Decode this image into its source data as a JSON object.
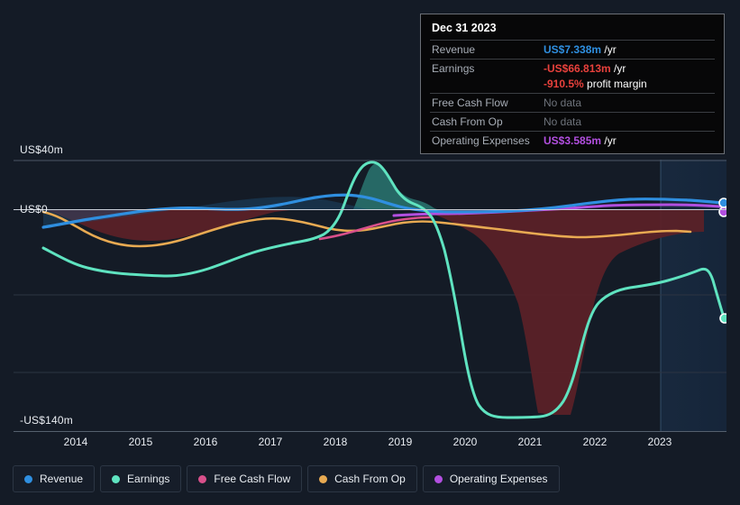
{
  "axes": {
    "y_top_label": "US$40m",
    "y_zero_label": "US$0",
    "y_bottom_label": "-US$140m",
    "x_ticks": [
      "2014",
      "2015",
      "2016",
      "2017",
      "2018",
      "2019",
      "2020",
      "2021",
      "2022",
      "2023"
    ]
  },
  "tooltip": {
    "date": "Dec 31 2023",
    "rows": [
      {
        "label": "Revenue",
        "value": "US$7.338m",
        "unit": " /yr",
        "color": "#2f8fe0",
        "nodata": false
      },
      {
        "label": "Earnings",
        "value": "-US$66.813m",
        "unit": " /yr",
        "color": "#e8413c",
        "nodata": false
      },
      {
        "label": "",
        "value": "-910.5%",
        "unit": " profit margin",
        "color": "#e8413c",
        "nodata": false,
        "sub": true
      },
      {
        "label": "Free Cash Flow",
        "value": "No data",
        "unit": "",
        "color": "#6e737b",
        "nodata": true
      },
      {
        "label": "Cash From Op",
        "value": "No data",
        "unit": "",
        "color": "#6e737b",
        "nodata": true
      },
      {
        "label": "Operating Expenses",
        "value": "US$3.585m",
        "unit": " /yr",
        "color": "#b24fe0",
        "nodata": false
      }
    ]
  },
  "legend": [
    {
      "label": "Revenue",
      "color": "#2f8fe0"
    },
    {
      "label": "Earnings",
      "color": "#5fe3c0"
    },
    {
      "label": "Free Cash Flow",
      "color": "#d9508b"
    },
    {
      "label": "Cash From Op",
      "color": "#e8aa52"
    },
    {
      "label": "Operating Expenses",
      "color": "#b24fe0"
    }
  ],
  "chart_data": {
    "type": "line",
    "title": "",
    "xlabel": "",
    "ylabel": "US$",
    "ylim": [
      -140,
      40
    ],
    "grid": true,
    "legend_position": "bottom",
    "currency": "USD",
    "units": "millions",
    "x": [
      "2013",
      "2014",
      "2015",
      "2016",
      "2017",
      "2018",
      "2018.5",
      "2019",
      "2019.5",
      "2020",
      "2020.5",
      "2021",
      "2021.5",
      "2022",
      "2022.5",
      "2023",
      "2023.5"
    ],
    "series": [
      {
        "name": "Revenue",
        "color": "#2f8fe0",
        "values": [
          -4.0,
          -1.0,
          2.0,
          3.0,
          4.5,
          7.0,
          12.0,
          9.0,
          5.5,
          4.0,
          4.0,
          5.0,
          6.5,
          7.5,
          7.8,
          7.5,
          7.338
        ]
      },
      {
        "name": "Earnings",
        "color": "#5fe3c0",
        "values": [
          -22.0,
          -8.0,
          -12.0,
          -28.0,
          -30.0,
          -20.0,
          32.0,
          28.0,
          12.0,
          -18.0,
          -35.0,
          -132.0,
          -140.0,
          -50.0,
          -42.0,
          -28.0,
          -66.813
        ]
      },
      {
        "name": "Free Cash Flow",
        "color": "#d9508b",
        "values": [
          null,
          null,
          null,
          null,
          null,
          -16.0,
          -13.0,
          -8.0,
          -6.0,
          null,
          null,
          null,
          null,
          null,
          null,
          null,
          null
        ]
      },
      {
        "name": "Cash From Op",
        "color": "#e8aa52",
        "values": [
          -2.0,
          -4.0,
          -14.0,
          -19.0,
          -14.0,
          -11.0,
          -6.0,
          -4.5,
          -7.0,
          -2.0,
          -5.0,
          -11.0,
          -12.0,
          -8.0,
          -10.0,
          -11.0,
          null
        ]
      },
      {
        "name": "Operating Expenses",
        "color": "#b24fe0",
        "values": [
          null,
          null,
          null,
          null,
          null,
          null,
          null,
          2.5,
          2.6,
          2.5,
          2.6,
          3.2,
          3.6,
          3.8,
          3.8,
          3.7,
          3.585
        ]
      }
    ]
  }
}
